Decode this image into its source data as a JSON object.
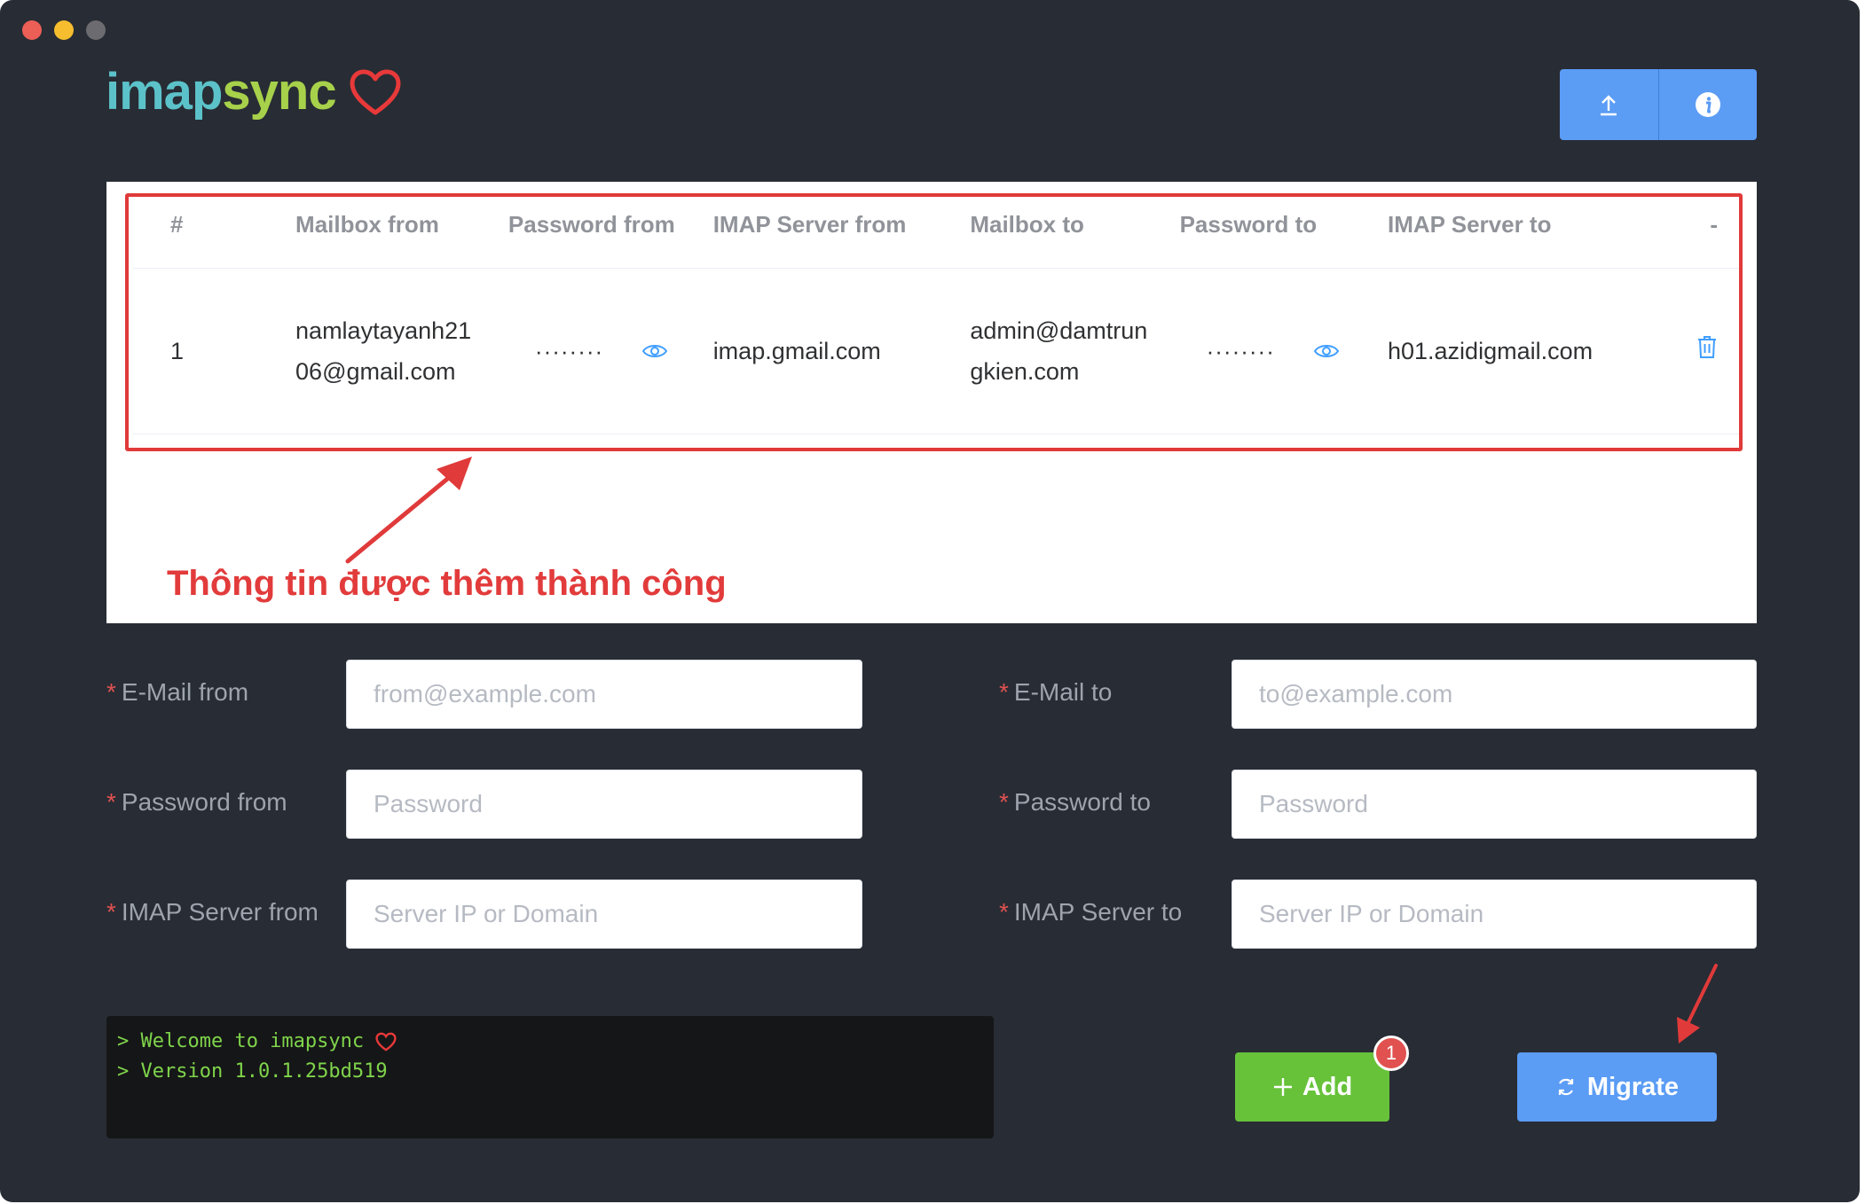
{
  "app": {
    "logo_part1": "imap",
    "logo_part2": "sync",
    "colors": {
      "background": "#282c34",
      "accent": "#5b9cf5",
      "success": "#67c23a",
      "danger": "#e03a3a"
    }
  },
  "toolbar": {
    "upload_icon": "upload-icon",
    "info_icon": "info-icon"
  },
  "table": {
    "headers": [
      "#",
      "Mailbox from",
      "Password from",
      "IMAP Server from",
      "Mailbox to",
      "Password to",
      "IMAP Server to",
      "-"
    ],
    "rows": [
      {
        "num": "1",
        "mailbox_from": "namlaytayanh2106@gmail.com",
        "password_from": "········",
        "server_from": "imap.gmail.com",
        "mailbox_to": "admin@damtrungkien.com",
        "password_to": "········",
        "server_to": "h01.azidigmail.com"
      }
    ]
  },
  "annotation": {
    "text": "Thông tin được thêm thành công"
  },
  "form": {
    "email_from": {
      "label": "E-Mail from",
      "placeholder": "from@example.com"
    },
    "email_to": {
      "label": "E-Mail to",
      "placeholder": "to@example.com"
    },
    "password_from": {
      "label": "Password from",
      "placeholder": "Password"
    },
    "password_to": {
      "label": "Password to",
      "placeholder": "Password"
    },
    "server_from": {
      "label": "IMAP Server from",
      "placeholder": "Server IP or Domain"
    },
    "server_to": {
      "label": "IMAP Server to",
      "placeholder": "Server IP or Domain"
    },
    "required_mark": "*"
  },
  "console": {
    "line1": "> Welcome to imapsync ",
    "line2": "> Version 1.0.1.25bd519"
  },
  "actions": {
    "add_label": "Add",
    "add_badge": "1",
    "migrate_label": "Migrate"
  }
}
